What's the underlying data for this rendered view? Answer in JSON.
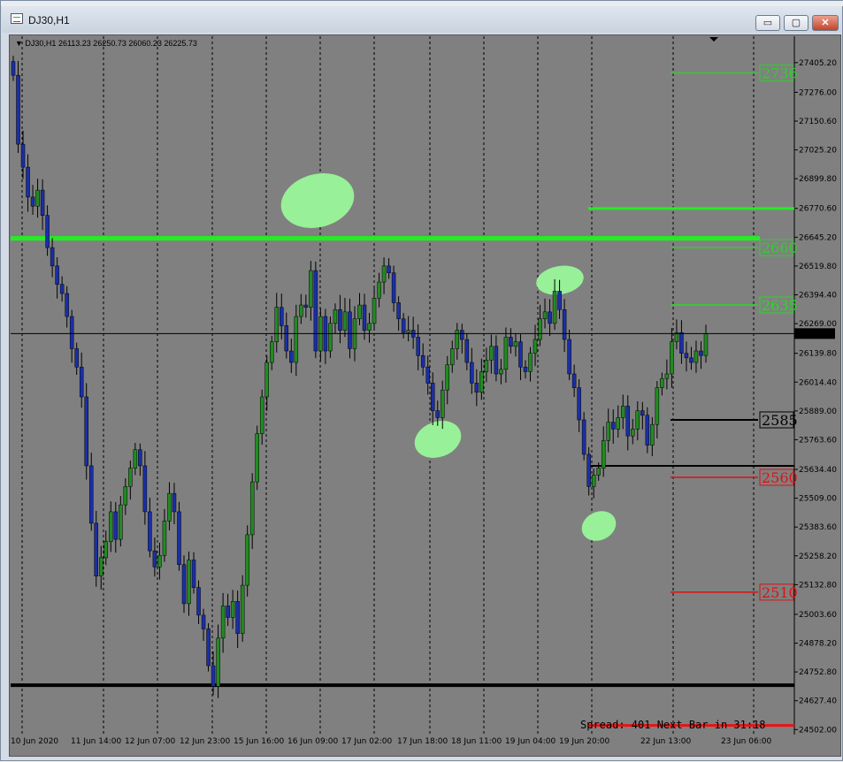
{
  "window": {
    "title": "DJ30,H1"
  },
  "buttons": {
    "minimize": "▭",
    "maximize": "▢",
    "close": "✕"
  },
  "chart_data": {
    "type": "candlestick",
    "symbol_info": "DJ30,H1  26113.23 26250.73 26060.23 26225.73",
    "current_price": "26225.73",
    "ylim": [
      24480,
      27520
    ],
    "y_ticks": [
      27405.2,
      27276.0,
      27150.6,
      27025.2,
      26899.8,
      26770.6,
      26645.2,
      26519.8,
      26394.4,
      26269.0,
      26139.8,
      26014.4,
      25889.0,
      25763.6,
      25634.4,
      25509.0,
      25383.6,
      25258.2,
      25132.8,
      25003.6,
      24878.2,
      24752.8,
      24627.4,
      24502.0
    ],
    "y_tick_labels": [
      "27405.20",
      "27276.00",
      "27150.60",
      "27025.20",
      "26899.80",
      "26770.60",
      "26645.20",
      "26519.80",
      "26394.40",
      "26269.00",
      "26139.80",
      "26014.40",
      "25889.00",
      "25763.60",
      "25634.40",
      "25509.00",
      "25383.60",
      "25258.20",
      "25132.80",
      "25003.60",
      "24878.20",
      "24752.80",
      "24627.40",
      "24502.00"
    ],
    "x_labels": [
      "10 Jun 2020",
      "11 Jun 14:00",
      "12 Jun 07:00",
      "12 Jun 23:00",
      "15 Jun 16:00",
      "16 Jun 09:00",
      "17 Jun 02:00",
      "17 Jun 18:00",
      "18 Jun 11:00",
      "19 Jun 04:00",
      "19 Jun 20:00",
      "22 Jun 13:00",
      "23 Jun 06:00"
    ],
    "levels": [
      {
        "label": "2736",
        "value": 27360,
        "color": "#33cc33"
      },
      {
        "label": "2660",
        "value": 26600,
        "color": "#33cc33"
      },
      {
        "label": "2635",
        "value": 26350,
        "color": "#22dd22"
      },
      {
        "label": "2585",
        "value": 25850,
        "color": "#000000"
      },
      {
        "label": "2560",
        "value": 25600,
        "color": "#dd1111"
      },
      {
        "label": "2510",
        "value": 25100,
        "color": "#dd1111"
      }
    ],
    "closes": [
      27350,
      27050,
      26950,
      26820,
      26780,
      26850,
      26740,
      26600,
      26520,
      26440,
      26400,
      26300,
      26160,
      26080,
      25950,
      25650,
      25400,
      25170,
      25250,
      25320,
      25450,
      25330,
      25480,
      25560,
      25640,
      25720,
      25650,
      25450,
      25280,
      25210,
      25260,
      25410,
      25530,
      25450,
      25220,
      25050,
      25240,
      25120,
      25000,
      24940,
      24780,
      24690,
      24900,
      25040,
      24990,
      25060,
      24920,
      25130,
      25350,
      25580,
      25790,
      25950,
      26100,
      26190,
      26340,
      26260,
      26150,
      26100,
      26300,
      26350,
      26340,
      26500,
      26150,
      26300,
      26150,
      26270,
      26330,
      26240,
      26320,
      26160,
      26290,
      26350,
      26240,
      26270,
      26380,
      26450,
      26520,
      26490,
      26360,
      26290,
      26230,
      26240,
      26210,
      26130,
      26080,
      26010,
      25890,
      25860,
      25980,
      26090,
      26160,
      26240,
      26200,
      26100,
      26010,
      25970,
      26060,
      26110,
      26170,
      26050,
      26070,
      26210,
      26170,
      26190,
      26080,
      26060,
      26140,
      26200,
      26290,
      26320,
      26270,
      26410,
      26330,
      26200,
      26050,
      25990,
      25850,
      25700,
      25560,
      25610,
      25640,
      25760,
      25840,
      25810,
      25860,
      25910,
      25780,
      25810,
      25890,
      25870,
      25740,
      25830,
      25990,
      26030,
      26050,
      26190,
      26230,
      26140,
      26120,
      26100,
      26150,
      26130,
      26225
    ],
    "annotation_text": "Spread: 401 Next Bar in 31:18",
    "colors": {
      "bull": "#228b22",
      "bear": "#1a2fa6",
      "wick": "#000000",
      "highlight": "#98f098",
      "background": "#808080"
    }
  }
}
